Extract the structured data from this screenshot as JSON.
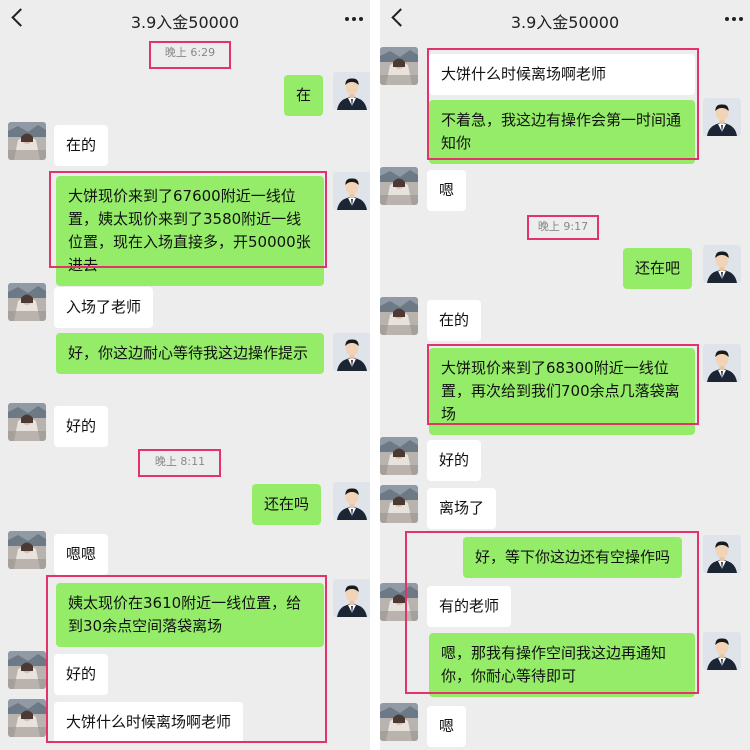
{
  "left": {
    "title": "3.9入金50000",
    "timestamps": [
      "晚上 6:29",
      "晚上 8:11"
    ],
    "messages": [
      "在",
      "在的",
      "大饼现价来到了67600附近一线位置，姨太现价来到了3580附近一线位置，现在入场直接多，开50000张进去",
      "入场了老师",
      "好，你这边耐心等待我这边操作提示",
      "好的",
      "还在吗",
      "嗯嗯",
      "姨太现价在3610附近一线位置，给到30余点空间落袋离场",
      "好的",
      "大饼什么时候离场啊老师"
    ]
  },
  "right": {
    "title": "3.9入金50000",
    "timestamps": [
      "晚上 9:17"
    ],
    "messages": [
      "大饼什么时候离场啊老师",
      "不着急，我这边有操作会第一时间通知你",
      "嗯",
      "还在吧",
      "在的",
      "大饼现价来到了68300附近一线位置，再次给到我们700余点几落袋离场",
      "好的",
      "离场了",
      "好，等下你这边还有空操作吗",
      "有的老师",
      "嗯，那我有操作空间我这边再通知你，你耐心等待即可",
      "嗯"
    ]
  },
  "colors": {
    "outgoing": "#95ec69",
    "incoming": "#ffffff",
    "highlight": "#e3336b",
    "background": "#ededed"
  },
  "icons": {
    "back": "chevron-left-icon",
    "more": "more-dots-icon",
    "client_avatar": "client-avatar-icon",
    "agent_avatar": "agent-avatar-icon"
  }
}
